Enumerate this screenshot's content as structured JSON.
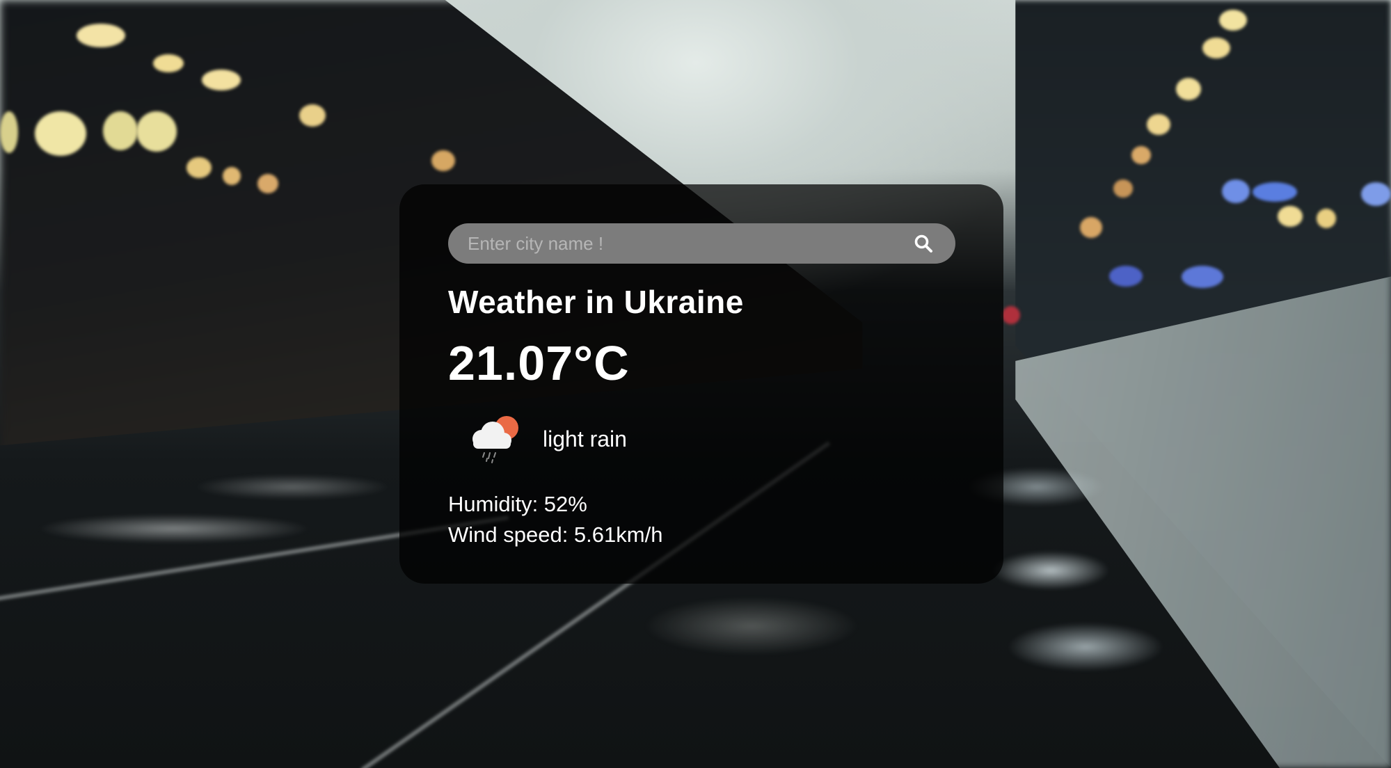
{
  "search": {
    "placeholder": "Enter city name !",
    "value": "",
    "button_icon": "search-icon"
  },
  "weather": {
    "title": "Weather in Ukraine",
    "temperature": "21.07°C",
    "condition_icon": "cloud-sun-rain-icon",
    "condition": "light rain",
    "humidity": "Humidity: 52%",
    "wind_speed": "Wind speed: 5.61km/h"
  },
  "background": {
    "scene": "blurred railway station at dusk"
  },
  "colors": {
    "card_background": "#000000b8",
    "search_background": "#7c7c7c",
    "text": "#ffffff",
    "sun": "#ea6a45",
    "cloud": "#f2f2f2"
  }
}
